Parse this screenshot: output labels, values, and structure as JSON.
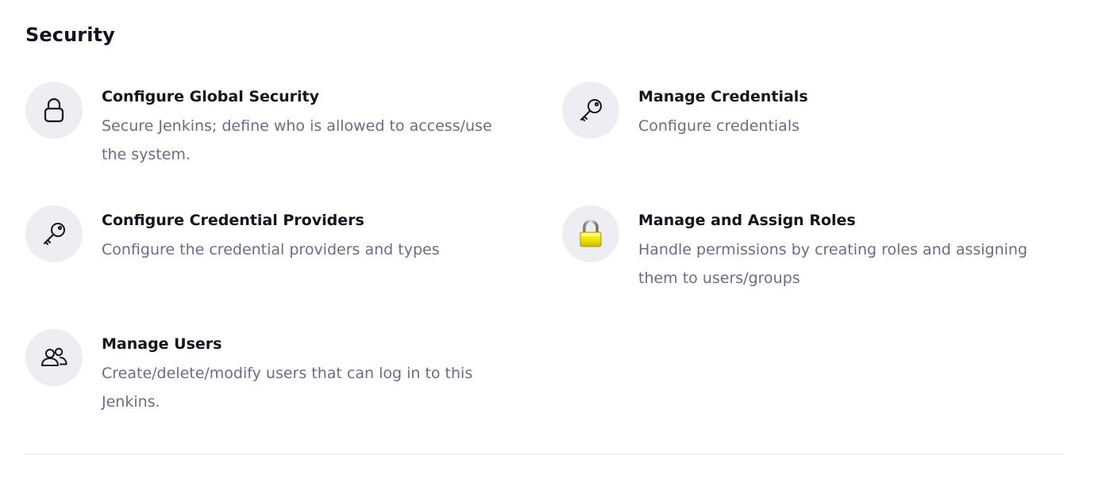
{
  "section": {
    "title": "Security"
  },
  "items": [
    {
      "title": "Configure Global Security",
      "description": "Secure Jenkins; define who is allowed to access/use the system.",
      "icon": "lock-icon"
    },
    {
      "title": "Manage Credentials",
      "description": "Configure credentials",
      "icon": "key-icon"
    },
    {
      "title": "Configure Credential Providers",
      "description": "Configure the credential providers and types",
      "icon": "key-icon"
    },
    {
      "title": "Manage and Assign Roles",
      "description": "Handle permissions by creating roles and assigning them to users/groups",
      "icon": "yellow-padlock-icon"
    },
    {
      "title": "Manage Users",
      "description": "Create/delete/modify users that can log in to this Jenkins.",
      "icon": "users-icon"
    }
  ],
  "colors": {
    "icon_background": "#ededf2",
    "title_text": "#14141f",
    "description_text": "#6d6b85",
    "divider": "#ededf2",
    "padlock_yellow": "#f2e40a"
  }
}
